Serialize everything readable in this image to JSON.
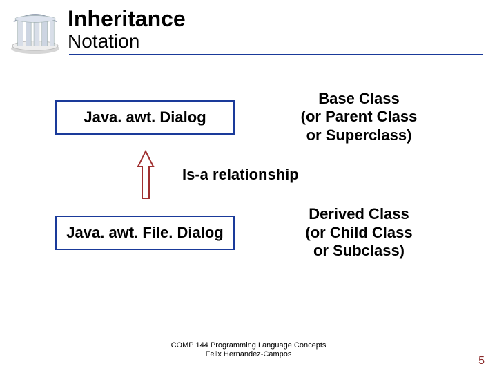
{
  "header": {
    "title": "Inheritance",
    "subtitle": "Notation"
  },
  "base": {
    "class_name": "Java. awt. Dialog",
    "desc_line1": "Base Class",
    "desc_line2": "(or Parent Class",
    "desc_line3": "or Superclass)"
  },
  "relationship_label": "Is-a relationship",
  "derived": {
    "class_name": "Java. awt. File. Dialog",
    "desc_line1": "Derived Class",
    "desc_line2": "(or Child Class",
    "desc_line3": "or Subclass)"
  },
  "footer": {
    "line1": "COMP 144 Programming Language Concepts",
    "line2": "Felix Hernandez-Campos"
  },
  "page_number": "5",
  "colors": {
    "accent": "#1a3a9a",
    "arrow_stroke": "#a03030"
  }
}
